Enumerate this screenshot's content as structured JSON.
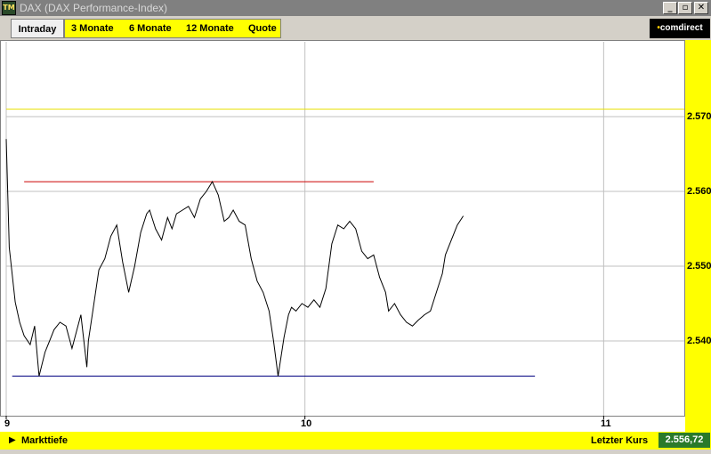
{
  "window": {
    "icon_text": "TM",
    "title": "DAX (DAX Performance-Index)",
    "buttons": [
      "_",
      "▫",
      "✕"
    ]
  },
  "tabs": {
    "active": "Intraday",
    "items": [
      "3 Monate",
      "6 Monate",
      "12 Monate",
      "Quote"
    ]
  },
  "brand": {
    "logo_dot": "•",
    "logo_text": "comdirect"
  },
  "bottom": {
    "markttiefe_label": "Markttiefe",
    "letzter_kurs_label": "Letzter Kurs",
    "letzter_kurs_value": "2.556,72"
  },
  "colors": {
    "accent_yellow": "#ffff00",
    "price_line": "#000000",
    "resistance_line": "#cc0000",
    "support_line": "#000080",
    "level_line": "#e8e000",
    "grid": "#c0c0c0",
    "value_badge": "#2a7a2a"
  },
  "chart_data": {
    "type": "line",
    "x_ticks": [
      9,
      10,
      11
    ],
    "x_tick_labels": [
      "9",
      "10",
      "11"
    ],
    "xlim": [
      9.0,
      11.27
    ],
    "y_ticks": [
      2540,
      2550,
      2560,
      2570
    ],
    "y_tick_labels": [
      "2.540",
      "2.550",
      "2.560",
      "2.570"
    ],
    "ylim": [
      2530.0,
      2580.0
    ],
    "grid": true,
    "horizontal_lines": [
      {
        "value": 2571.0,
        "x_range": [
          9.0,
          11.27
        ],
        "color": "#e8e000"
      },
      {
        "value": 2561.3,
        "x_range": [
          9.06,
          10.23
        ],
        "color": "#cc0000"
      },
      {
        "value": 2535.3,
        "x_range": [
          9.02,
          10.77
        ],
        "color": "#000080"
      }
    ],
    "series": [
      {
        "x": [
          9.0,
          9.01,
          9.03,
          9.045,
          9.06,
          9.08,
          9.095,
          9.11,
          9.13,
          9.145,
          9.16,
          9.18,
          9.2,
          9.22,
          9.25,
          9.27,
          9.275,
          9.29,
          9.31,
          9.33,
          9.35,
          9.37,
          9.39,
          9.41,
          9.43,
          9.45,
          9.47,
          9.48,
          9.5,
          9.52,
          9.54,
          9.555,
          9.57,
          9.59,
          9.61,
          9.63,
          9.65,
          9.67,
          9.69,
          9.71,
          9.73,
          9.745,
          9.76,
          9.78,
          9.8,
          9.82,
          9.84,
          9.86,
          9.88,
          9.895,
          9.91,
          9.93,
          9.945,
          9.955,
          9.97,
          9.99,
          10.01,
          10.03,
          10.05,
          10.07,
          10.09,
          10.11,
          10.13,
          10.15,
          10.17,
          10.19,
          10.21,
          10.23,
          10.25,
          10.27,
          10.28,
          10.3,
          10.32,
          10.34,
          10.36,
          10.38,
          10.4,
          10.42,
          10.44,
          10.46,
          10.47,
          10.49,
          10.51,
          10.53
        ],
        "values": [
          2567.0,
          2552.5,
          2545.2,
          2542.5,
          2540.7,
          2539.5,
          2542.0,
          2535.3,
          2538.5,
          2540.0,
          2541.5,
          2542.5,
          2542.0,
          2539.0,
          2543.5,
          2536.5,
          2540.0,
          2544.0,
          2549.5,
          2551.0,
          2554.0,
          2555.5,
          2550.5,
          2546.5,
          2550.0,
          2554.5,
          2557.0,
          2557.5,
          2555.0,
          2553.5,
          2556.5,
          2555.0,
          2557.0,
          2557.5,
          2558.0,
          2556.5,
          2559.0,
          2560.0,
          2561.3,
          2559.5,
          2556.0,
          2556.5,
          2557.5,
          2556.0,
          2555.5,
          2551.0,
          2548.0,
          2546.5,
          2544.0,
          2540.0,
          2535.3,
          2540.5,
          2543.5,
          2544.5,
          2544.0,
          2545.0,
          2544.5,
          2545.5,
          2544.5,
          2547.0,
          2553.0,
          2555.5,
          2555.0,
          2556.0,
          2555.0,
          2552.0,
          2551.0,
          2551.5,
          2548.5,
          2546.5,
          2544.0,
          2545.0,
          2543.5,
          2542.5,
          2542.0,
          2542.8,
          2543.5,
          2544.0,
          2546.5,
          2549.0,
          2551.5,
          2553.5,
          2555.5,
          2556.72
        ]
      }
    ]
  }
}
